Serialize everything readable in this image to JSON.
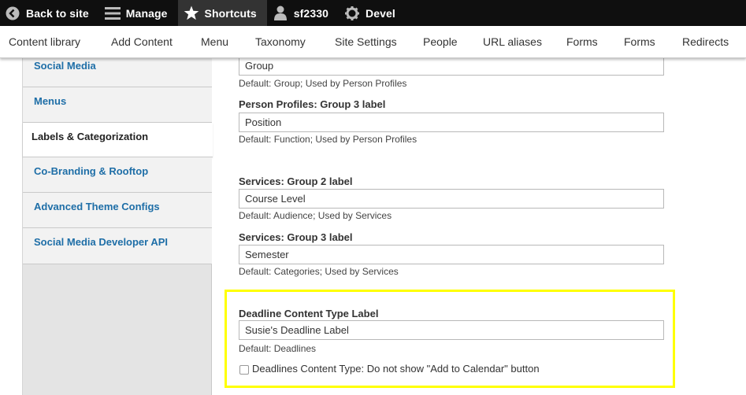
{
  "toolbar": {
    "back_label": "Back to site",
    "manage_label": "Manage",
    "shortcuts_label": "Shortcuts",
    "user_label": "sf2330",
    "devel_label": "Devel"
  },
  "tray": {
    "items": [
      "Content library",
      "Add Content",
      "Menu",
      "Taxonomy",
      "Site Settings",
      "People",
      "URL aliases",
      "Forms",
      "Forms",
      "Redirects"
    ]
  },
  "sidebar": {
    "items": [
      {
        "label": "Social Media"
      },
      {
        "label": "Menus"
      },
      {
        "label": "Labels & Categorization"
      },
      {
        "label": "Co-Branding & Rooftop"
      },
      {
        "label": "Advanced Theme Configs"
      },
      {
        "label": "Social Media Developer API"
      }
    ]
  },
  "form": {
    "group_partial": {
      "value": "Group",
      "description": "Default: Group; Used by Person Profiles"
    },
    "pp_group3": {
      "label": "Person Profiles: Group 3 label",
      "value": "Position",
      "description": "Default: Function; Used by Person Profiles"
    },
    "svc_group2": {
      "label": "Services: Group 2 label",
      "value": "Course Level",
      "description": "Default: Audience; Used by Services"
    },
    "svc_group3": {
      "label": "Services: Group 3 label",
      "value": "Semester",
      "description": "Default: Categories; Used by Services"
    },
    "deadline": {
      "label": "Deadline Content Type Label",
      "value": "Susie's Deadline Label",
      "description": "Default: Deadlines"
    },
    "deadline_checkbox": {
      "label": "Deadlines Content Type: Do not show \"Add to Calendar\" button",
      "checked": false
    }
  },
  "colors": {
    "highlight": "#ffff00",
    "link": "#1e6ea7",
    "toolbar": "#0f0f0f"
  }
}
